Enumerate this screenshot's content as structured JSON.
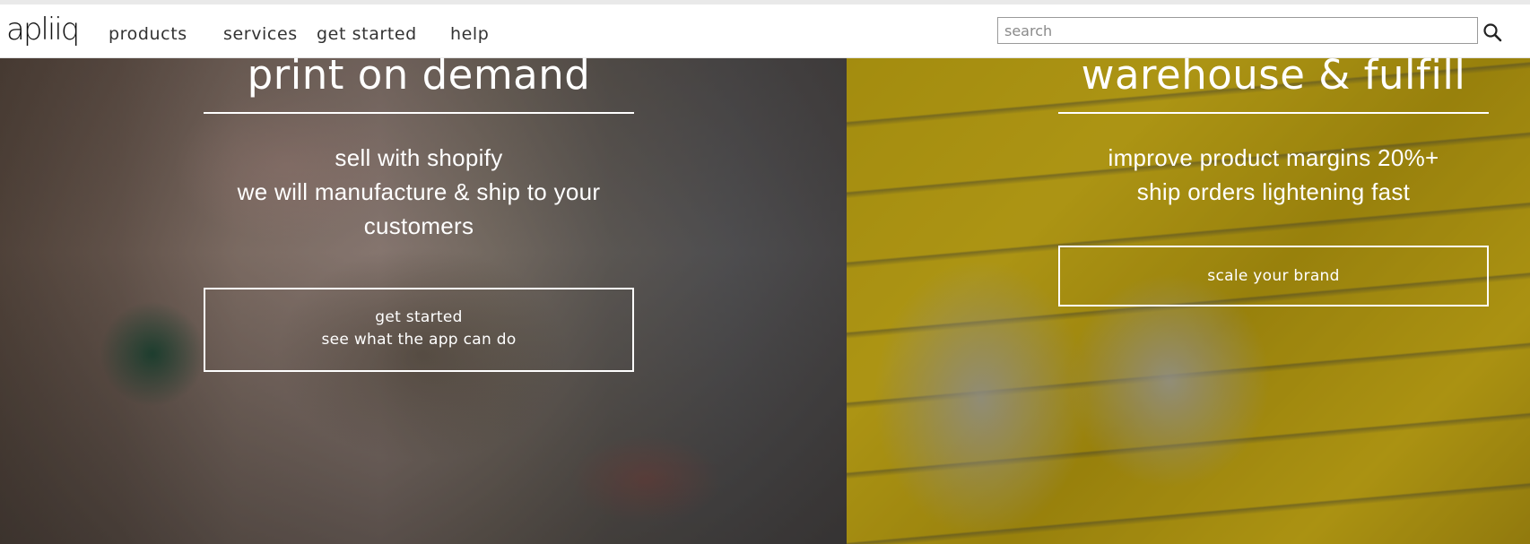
{
  "brand": {
    "logo_text": "apliiq"
  },
  "nav": {
    "products": "products",
    "services": "services",
    "get_started": "get started",
    "help": "help"
  },
  "search": {
    "placeholder": "search",
    "value": ""
  },
  "left_panel": {
    "title": "print on demand",
    "line1": "sell with shopify",
    "line2": "we will manufacture & ship to your",
    "line3": "customers",
    "button_line1": "get started",
    "button_line2": "see what the app can do"
  },
  "right_panel": {
    "title": "warehouse & fulfill",
    "line1": "improve product margins 20%+",
    "line2": "ship orders lightening fast",
    "button": "scale your brand"
  },
  "colors": {
    "text_on_hero": "#ffffff",
    "nav_text": "#333333",
    "search_border": "#9a9a9a"
  },
  "icons": {
    "search": "search-icon"
  }
}
